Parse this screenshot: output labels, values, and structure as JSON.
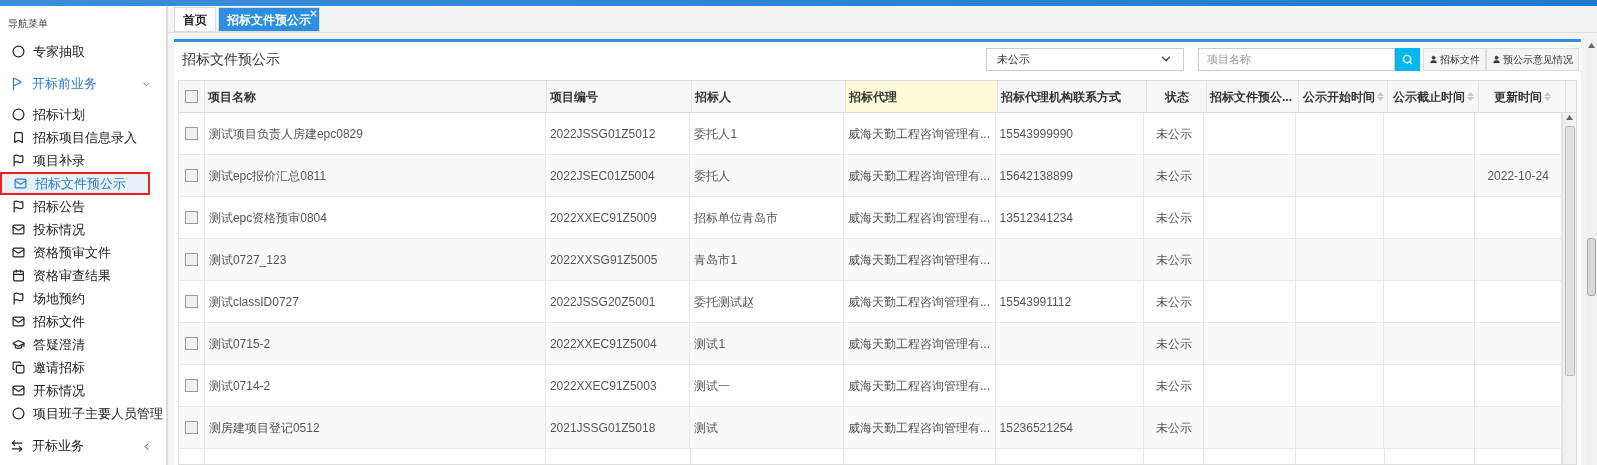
{
  "sidebar": {
    "title": "导航菜单",
    "items": [
      {
        "kind": "item",
        "label": "专家抽取",
        "selected": false
      },
      {
        "kind": "group",
        "label": "开标前业务",
        "expanded": true,
        "children": [
          {
            "label": "招标计划",
            "selected": false
          },
          {
            "label": "招标项目信息录入",
            "selected": false
          },
          {
            "label": "项目补录",
            "selected": false
          },
          {
            "label": "招标文件预公示",
            "selected": true
          },
          {
            "label": "招标公告",
            "selected": false
          },
          {
            "label": "投标情况",
            "selected": false
          },
          {
            "label": "资格预审文件",
            "selected": false
          },
          {
            "label": "资格审查结果",
            "selected": false
          },
          {
            "label": "场地预约",
            "selected": false
          },
          {
            "label": "招标文件",
            "selected": false
          },
          {
            "label": "答疑澄清",
            "selected": false
          },
          {
            "label": "邀请招标",
            "selected": false
          },
          {
            "label": "开标情况",
            "selected": false
          },
          {
            "label": "项目班子主要人员管理",
            "selected": false
          }
        ]
      },
      {
        "kind": "group",
        "label": "开标业务",
        "expanded": false
      }
    ]
  },
  "tabs": [
    {
      "label": "首页",
      "selected": false,
      "closable": false
    },
    {
      "label": "招标文件预公示",
      "selected": true,
      "closable": true
    }
  ],
  "panel": {
    "title": "招标文件预公示",
    "status_filter": "未公示",
    "search": {
      "placeholder": "项目名称"
    },
    "buttons": [
      "招标文件",
      "预公示意见情况"
    ]
  },
  "table": {
    "all_checked": false,
    "columns": [
      {
        "label": "项目名称",
        "sortable": false,
        "highlighted": false
      },
      {
        "label": "项目编号",
        "sortable": false,
        "highlighted": false
      },
      {
        "label": "招标人",
        "sortable": false,
        "highlighted": false
      },
      {
        "label": "招标代理",
        "sortable": false,
        "highlighted": true
      },
      {
        "label": "招标代理机构联系方式",
        "sortable": false,
        "highlighted": false
      },
      {
        "label": "状态",
        "sortable": false,
        "highlighted": false
      },
      {
        "label": "招标文件预公...",
        "sortable": false,
        "highlighted": false
      },
      {
        "label": "公示开始时间",
        "sortable": true,
        "highlighted": false
      },
      {
        "label": "公示截止时间",
        "sortable": true,
        "highlighted": false
      },
      {
        "label": "更新时间",
        "sortable": true,
        "highlighted": false
      }
    ],
    "rows": [
      {
        "checked": false,
        "cells": [
          "测试项目负责人房建epc0829",
          "2022JSSG01Z5012",
          "委托人1",
          "威海天勤工程咨询管理有...",
          "15543999990",
          "未公示",
          "",
          "",
          "",
          ""
        ]
      },
      {
        "checked": false,
        "cells": [
          "测试epc报价汇总0811",
          "2022JSEC01Z5004",
          "委托人",
          "威海天勤工程咨询管理有...",
          "15642138899",
          "未公示",
          "",
          "",
          "",
          "2022-10-24"
        ]
      },
      {
        "checked": false,
        "cells": [
          "测试epc资格预审0804",
          "2022XXEC91Z5009",
          "招标单位青岛市",
          "威海天勤工程咨询管理有...",
          "13512341234",
          "未公示",
          "",
          "",
          "",
          ""
        ]
      },
      {
        "checked": false,
        "cells": [
          "测试0727_123",
          "2022XXSG91Z5005",
          "青岛市1",
          "威海天勤工程咨询管理有...",
          "",
          "未公示",
          "",
          "",
          "",
          ""
        ]
      },
      {
        "checked": false,
        "cells": [
          "测试classID0727",
          "2022JSSG20Z5001",
          "委托测试赵",
          "威海天勤工程咨询管理有...",
          "15543991112",
          "未公示",
          "",
          "",
          "",
          ""
        ]
      },
      {
        "checked": false,
        "cells": [
          "测试0715-2",
          "2022XXEC91Z5004",
          "测试1",
          "威海天勤工程咨询管理有...",
          "",
          "未公示",
          "",
          "",
          "",
          ""
        ]
      },
      {
        "checked": false,
        "cells": [
          "测试0714-2",
          "2022XXEC91Z5003",
          "测试一",
          "威海天勤工程咨询管理有...",
          "",
          "未公示",
          "",
          "",
          "",
          ""
        ]
      },
      {
        "checked": false,
        "cells": [
          "测房建项目登记0512",
          "2021JSSG01Z5018",
          "测试",
          "威海天勤工程咨询管理有...",
          "15236521254",
          "未公示",
          "",
          "",
          "",
          ""
        ]
      }
    ]
  }
}
